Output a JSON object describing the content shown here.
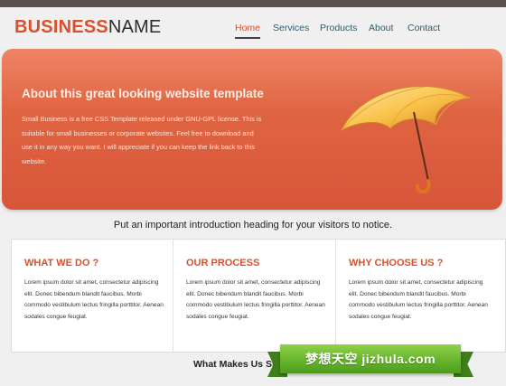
{
  "logo": {
    "part1": "BUSINESS",
    "part2": "NAME"
  },
  "nav": {
    "items": [
      {
        "label": "Home"
      },
      {
        "label": "Services"
      },
      {
        "label": "Products"
      },
      {
        "label": "About"
      },
      {
        "label": "Contact"
      }
    ],
    "active": "Home"
  },
  "hero": {
    "heading": "About this great looking website template",
    "body": "Small Business is a free CSS Template released under GNU-GPL license. This is suitable for small businesses or corporate websites. Feel free to download and use it in any way you want. I will appreciate if you can keep the link back to this website.",
    "image_icon": "umbrella-icon"
  },
  "intro": {
    "text": "Put an important introduction heading for your visitors to notice."
  },
  "features": [
    {
      "title": "WHAT WE DO ?",
      "body": "Lorem ipsum dolor sit amet, consectetur adipiscing elit. Donec bibendum blandit faucibus. Morbi commodo vestibulum lectus fringilla porttitor. Aenean sodales congue feugiat."
    },
    {
      "title": "OUR PROCESS",
      "body": "Lorem ipsum dolor sit amet, consectetur adipiscing elit. Donec bibendum blandit faucibus. Morbi commodo vestibulum lectus fringilla porttitor. Aenean sodales congue feugiat."
    },
    {
      "title": "WHY CHOOSE US ?",
      "body": "Lorem ipsum dolor sit amet, consectetur adipiscing elit. Donec bibendum blandit faucibus. Morbi commodo vestibulum lectus fringilla porttitor. Aenean sodales congue feugiat."
    }
  ],
  "section": {
    "heading_partial": "What Makes Us Sta"
  },
  "watermark": {
    "text": "梦想天空 jizhula.com"
  },
  "colors": {
    "accent": "#d9502c",
    "nav_link": "#245f74",
    "hero_bg": "#df6441",
    "ribbon": "#63b22a"
  }
}
